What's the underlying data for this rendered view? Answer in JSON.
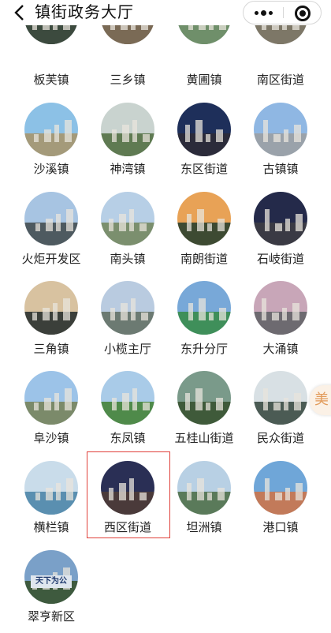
{
  "header": {
    "title": "镇街政务大厅"
  },
  "towns": [
    {
      "name": "板芙镇"
    },
    {
      "name": "三乡镇"
    },
    {
      "name": "黄圃镇"
    },
    {
      "name": "南区街道"
    },
    {
      "name": "沙溪镇"
    },
    {
      "name": "神湾镇"
    },
    {
      "name": "东区街道"
    },
    {
      "name": "古镇镇"
    },
    {
      "name": "火炬开发区"
    },
    {
      "name": "南头镇"
    },
    {
      "name": "南朗街道"
    },
    {
      "name": "石岐街道"
    },
    {
      "name": "三角镇"
    },
    {
      "name": "小榄主厅"
    },
    {
      "name": "东升分厅"
    },
    {
      "name": "大涌镇"
    },
    {
      "name": "阜沙镇"
    },
    {
      "name": "东凤镇"
    },
    {
      "name": "五桂山街道"
    },
    {
      "name": "民众街道"
    },
    {
      "name": "横栏镇"
    },
    {
      "name": "西区街道"
    },
    {
      "name": "坦洲镇"
    },
    {
      "name": "港口镇"
    },
    {
      "name": "翠亨新区",
      "sign_text": "天下为公"
    }
  ],
  "floating_tab": {
    "text": "美"
  },
  "colors": {
    "highlight_border": "#e0403a",
    "text": "#222222",
    "background": "#ffffff"
  }
}
